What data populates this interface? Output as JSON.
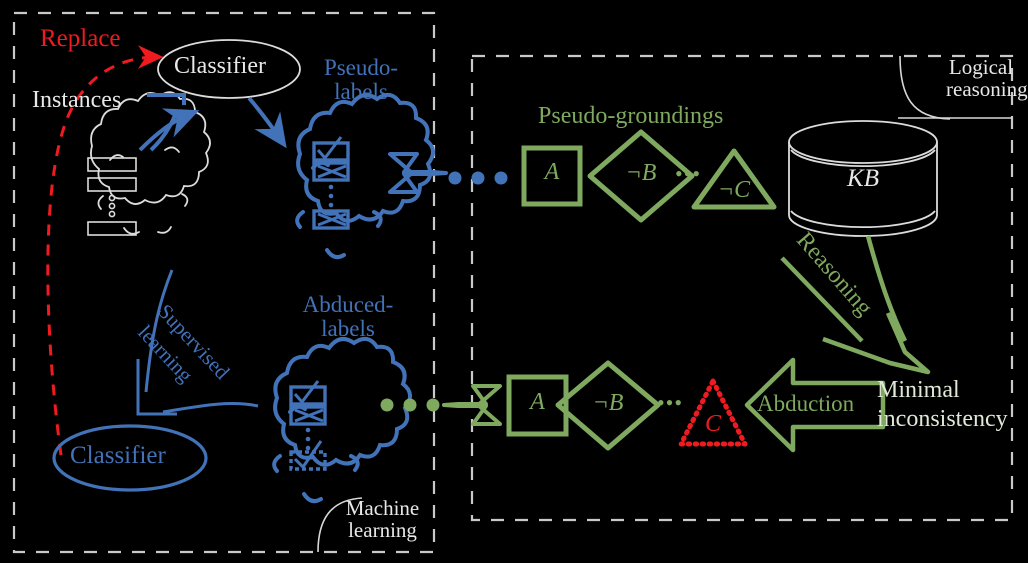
{
  "figure": {
    "title": "Abductive learning framework diagram",
    "colors": {
      "blue": "#4272b8",
      "green": "#7fa95f",
      "red": "#ef1b20",
      "white": "#e8e8e8",
      "background": "#000000"
    }
  },
  "machine_learning_panel": {
    "label": "Machine\nlearning",
    "replace_label": "Replace",
    "instances_label": "Instances",
    "classifier_top_label": "Classifier",
    "classifier_bottom_label": "Classifier",
    "pseudo_labels_label": "Pseudo-\nlabels",
    "abduced_labels_label": "Abduced-\nlabels",
    "supervised_learning_label_line1": "Supervised",
    "supervised_learning_label_line2": "learning"
  },
  "logical_reasoning_panel": {
    "label": "Logical\nreasoning",
    "pseudo_groundings_label": "Pseudo-groundings",
    "kb_label": "KB",
    "reasoning_label": "Reasoning",
    "abduction_label": "Abduction",
    "minimal_inconsistency_label_line1": "Minimal",
    "minimal_inconsistency_label_line2": "inconsistency"
  },
  "symbols": {
    "pseudo_groundings": [
      {
        "shape": "square",
        "text": "A"
      },
      {
        "shape": "diamond",
        "text": "¬B"
      },
      {
        "shape": "ellipsis",
        "text": "•••"
      },
      {
        "shape": "triangle",
        "text": "¬C"
      }
    ],
    "abduced_groundings": [
      {
        "shape": "square",
        "text": "A"
      },
      {
        "shape": "diamond",
        "text": "¬B"
      },
      {
        "shape": "ellipsis",
        "text": "•••"
      },
      {
        "shape": "triangle_dotted_red",
        "text": "C"
      }
    ]
  },
  "flow_dots": {
    "top_row_count": 3,
    "bottom_row_count": 3,
    "top_color": "#4272b8",
    "bottom_color": "#7fa95f"
  }
}
